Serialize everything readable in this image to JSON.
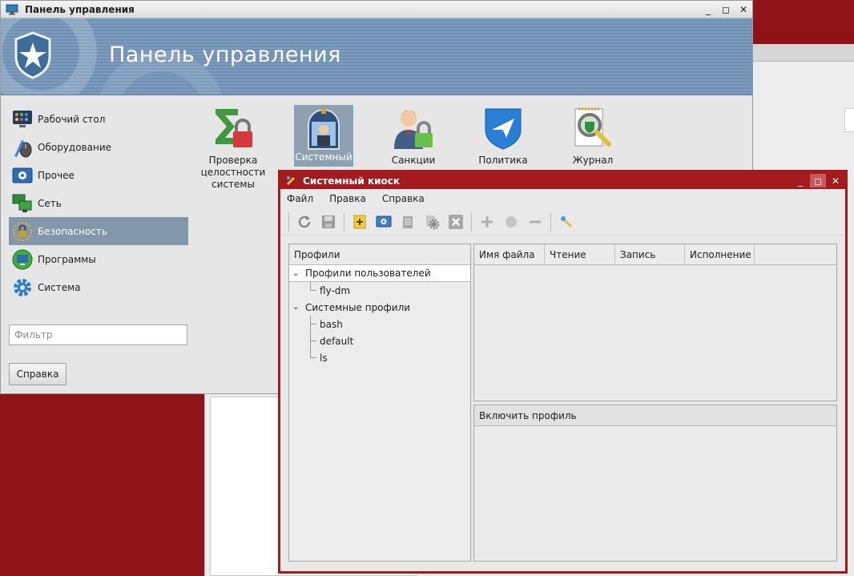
{
  "control_panel": {
    "title": "Панель управления",
    "banner_title": "Панель управления",
    "sidebar": [
      {
        "label": "Рабочий стол",
        "icon": "desktop-icon"
      },
      {
        "label": "Оборудование",
        "icon": "hardware-icon"
      },
      {
        "label": "Прочее",
        "icon": "misc-icon"
      },
      {
        "label": "Сеть",
        "icon": "network-icon"
      },
      {
        "label": "Безопасность",
        "icon": "security-icon",
        "active": true
      },
      {
        "label": "Программы",
        "icon": "programs-icon"
      },
      {
        "label": "Система",
        "icon": "system-icon"
      }
    ],
    "filter_placeholder": "Фильтр",
    "help_button": "Справка",
    "tiles": [
      {
        "label": "Проверка\nцелостности\nсистемы",
        "icon": "integrity-check-icon"
      },
      {
        "label": "Системный",
        "icon": "system-kiosk-icon",
        "selected": true
      },
      {
        "label": "Санкции",
        "icon": "sanctions-icon"
      },
      {
        "label": "Политика",
        "icon": "policy-icon"
      },
      {
        "label": "Журнал",
        "icon": "journal-icon"
      }
    ]
  },
  "kiosk": {
    "title": "Системный киоск",
    "menu": [
      "Файл",
      "Правка",
      "Справка"
    ],
    "toolbar_icons": [
      "refresh-icon",
      "save-icon",
      "add-profile-icon",
      "screen-icon",
      "clipboard-icon",
      "settings-icon",
      "delete-icon",
      "plus-icon",
      "circle-icon",
      "minus-icon",
      "wand-icon"
    ],
    "profiles_header": "Профили",
    "tree": {
      "user_profiles": "Профили пользователей",
      "user_items": [
        "fly-dm"
      ],
      "system_profiles": "Системные профили",
      "system_items": [
        "bash",
        "default",
        "ls"
      ]
    },
    "file_columns": [
      "Имя файла",
      "Чтение",
      "Запись",
      "Исполнение"
    ],
    "include_header": "Включить профиль"
  },
  "colors": {
    "kiosk_frame": "#a31b1f",
    "banner": "#7596ba",
    "selection": "#8397aa",
    "desktop": "#8e1216"
  }
}
